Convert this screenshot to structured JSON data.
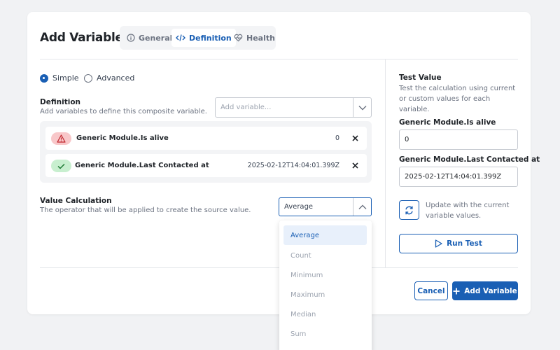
{
  "dialog": {
    "title": "Add Variable",
    "tabs": [
      {
        "label": "General",
        "icon": "info-icon",
        "active": false
      },
      {
        "label": "Definition",
        "icon": "code-icon",
        "active": true
      },
      {
        "label": "Health",
        "icon": "heart-pulse-icon",
        "active": false
      }
    ]
  },
  "mode": {
    "options": [
      {
        "label": "Simple",
        "selected": true
      },
      {
        "label": "Advanced",
        "selected": false
      }
    ]
  },
  "definition": {
    "title": "Definition",
    "description": "Add variables to define this composite variable.",
    "add_placeholder": "Add variable...",
    "variables": [
      {
        "name": "Generic Module.Is alive",
        "value": "0",
        "status": "error",
        "status_icon": "warning-triangle-icon"
      },
      {
        "name": "Generic Module.Last Contacted at",
        "value": "2025-02-12T14:04:01.399Z",
        "status": "ok",
        "status_icon": "check-icon"
      }
    ]
  },
  "value_calculation": {
    "title": "Value Calculation",
    "description": "The operator that will be applied to create the source value.",
    "selected": "Average",
    "options": [
      "Average",
      "Count",
      "Minimum",
      "Maximum",
      "Median",
      "Sum"
    ]
  },
  "test_value": {
    "title": "Test Value",
    "description": "Test the calculation using current or custom values for each variable.",
    "fields": [
      {
        "label": "Generic Module.Is alive",
        "value": "0"
      },
      {
        "label": "Generic Module.Last Contacted at",
        "value": "2025-02-12T14:04:01.399Z"
      }
    ],
    "update_text": "Update with the current variable values.",
    "run_label": "Run Test"
  },
  "footer": {
    "cancel_label": "Cancel",
    "add_label": "Add Variable"
  },
  "colors": {
    "accent": "#1a5fb4",
    "error_badge": "#f8c7c9",
    "ok_badge": "#c8efcf",
    "background": "#f1f2f4"
  }
}
